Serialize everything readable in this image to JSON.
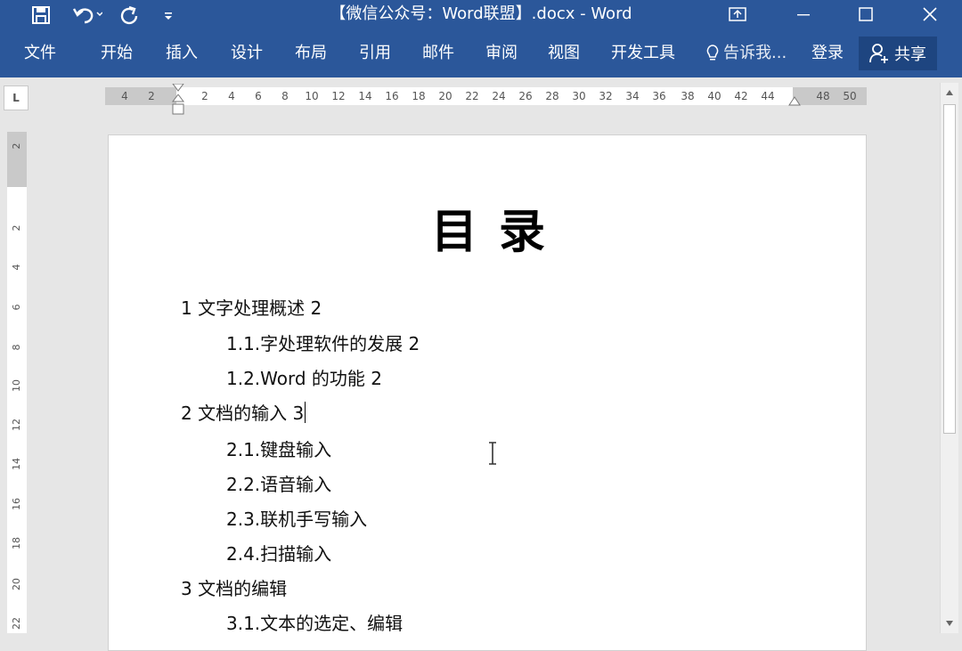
{
  "title_bar": {
    "title": "【微信公众号：Word联盟】.docx - Word",
    "quick_access": [
      "save-icon",
      "undo-icon",
      "redo-icon",
      "customize-icon"
    ]
  },
  "menu": {
    "items": [
      "文件",
      "开始",
      "插入",
      "设计",
      "布局",
      "引用",
      "邮件",
      "审阅",
      "视图",
      "开发工具"
    ],
    "tell_me": "告诉我...",
    "login": "登录",
    "share": "共享"
  },
  "ruler": {
    "corner": "L",
    "h_ticks": [
      "4",
      "2",
      "2",
      "4",
      "6",
      "8",
      "10",
      "12",
      "14",
      "16",
      "18",
      "20",
      "22",
      "24",
      "26",
      "28",
      "30",
      "32",
      "34",
      "36",
      "38",
      "40",
      "42",
      "44",
      "48",
      "50"
    ],
    "v_ticks": [
      "2",
      "2",
      "4",
      "6",
      "8",
      "10",
      "12",
      "14",
      "16",
      "18",
      "20",
      "22"
    ]
  },
  "document": {
    "title": "目录",
    "toc": [
      {
        "text": "1  文字处理概述 2",
        "level": 1
      },
      {
        "text": "1.1.字处理软件的发展 2",
        "level": 2
      },
      {
        "text": "1.2.Word 的功能 2",
        "level": 2
      },
      {
        "text": "2  文档的输入 3",
        "level": 1,
        "caret": true
      },
      {
        "text": "2.1.键盘输入",
        "level": 2
      },
      {
        "text": "2.2.语音输入",
        "level": 2
      },
      {
        "text": "2.3.联机手写输入",
        "level": 2
      },
      {
        "text": "2.4.扫描输入",
        "level": 2
      },
      {
        "text": "3  文档的编辑",
        "level": 1
      },
      {
        "text": "3.1.文本的选定、编辑",
        "level": 2
      }
    ]
  },
  "colors": {
    "ribbon": "#2b579a",
    "share_bg": "#1e4580",
    "page": "#ffffff",
    "workspace": "#e6e6e6"
  }
}
